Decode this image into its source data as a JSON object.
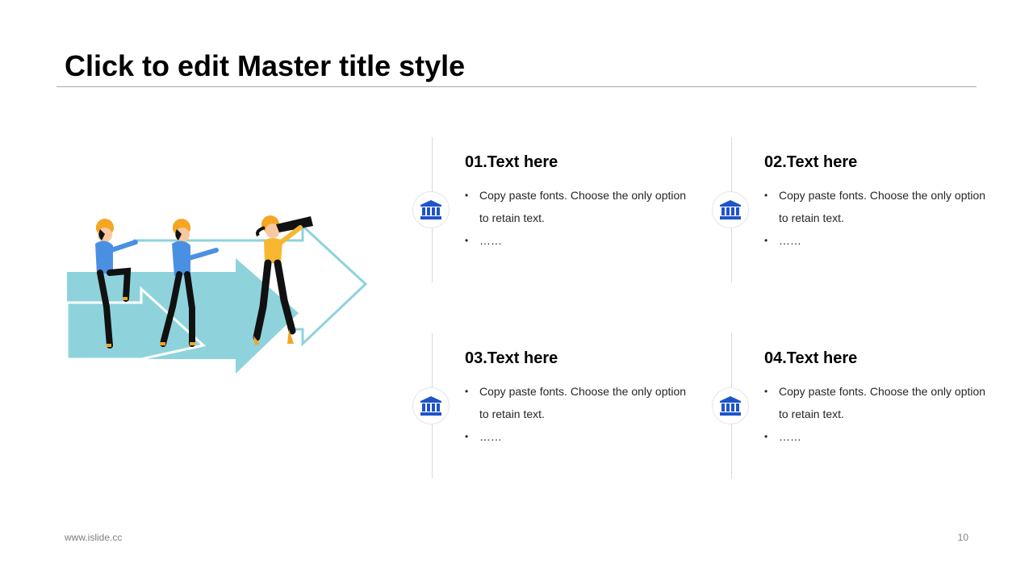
{
  "slide": {
    "title": "Click to edit Master title style"
  },
  "colors": {
    "accent_icon": "#1f54c9",
    "arrow_fill": "#8ed3dc",
    "arrow_outline": "#8ed3dc",
    "shirt_blue": "#4a90e2",
    "shirt_yellow": "#f7b731",
    "helmet": "#f5a623"
  },
  "illustration": {
    "icon": "three-workers-walking-with-arrows-and-telescope"
  },
  "items": [
    {
      "heading": "01.Text here",
      "bullets": [
        "Copy paste fonts. Choose the only option to retain text.",
        "……"
      ],
      "icon": "bank-icon"
    },
    {
      "heading": "02.Text here",
      "bullets": [
        "Copy paste fonts. Choose the only option to retain text.",
        "……"
      ],
      "icon": "bank-icon"
    },
    {
      "heading": "03.Text here",
      "bullets": [
        "Copy paste fonts. Choose the only option to retain text.",
        "……"
      ],
      "icon": "bank-icon"
    },
    {
      "heading": "04.Text here",
      "bullets": [
        "Copy paste fonts. Choose the only option to retain text.",
        "……"
      ],
      "icon": "bank-icon"
    }
  ],
  "footer": {
    "url": "www.islide.cc",
    "page_number": "10"
  }
}
